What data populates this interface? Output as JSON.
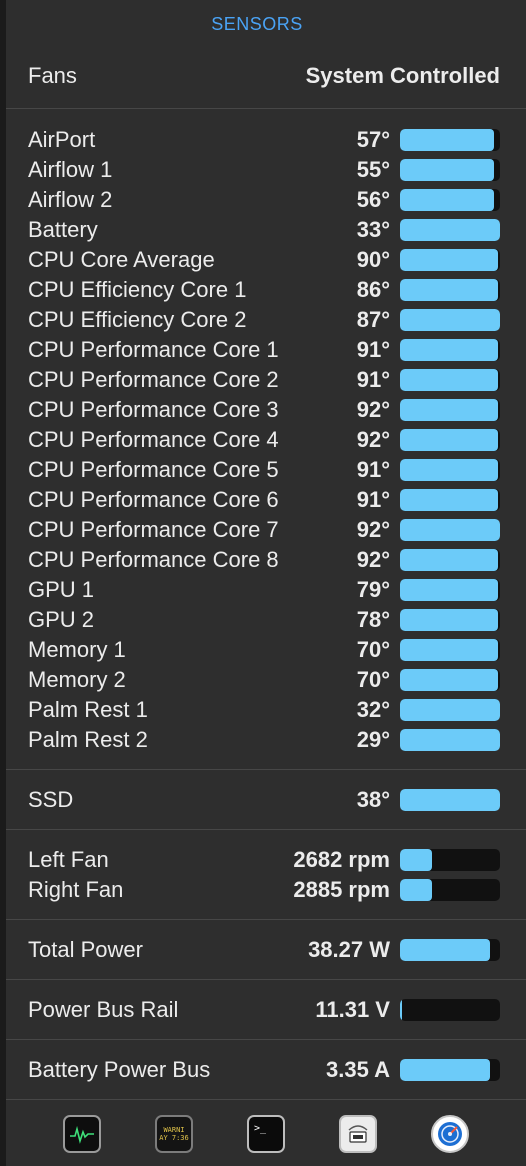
{
  "title": "SENSORS",
  "fans_header": {
    "label": "Fans",
    "value": "System Controlled"
  },
  "temperatures": [
    {
      "label": "AirPort",
      "value": "57°",
      "level": 0.94
    },
    {
      "label": "Airflow 1",
      "value": "55°",
      "level": 0.94
    },
    {
      "label": "Airflow 2",
      "value": "56°",
      "level": 0.94
    },
    {
      "label": "Battery",
      "value": "33°",
      "level": 1.0
    },
    {
      "label": "CPU Core Average",
      "value": "90°",
      "level": 0.98
    },
    {
      "label": "CPU Efficiency Core 1",
      "value": "86°",
      "level": 0.98
    },
    {
      "label": "CPU Efficiency Core 2",
      "value": "87°",
      "level": 1.0
    },
    {
      "label": "CPU Performance Core 1",
      "value": "91°",
      "level": 0.98
    },
    {
      "label": "CPU Performance Core 2",
      "value": "91°",
      "level": 0.98
    },
    {
      "label": "CPU Performance Core 3",
      "value": "92°",
      "level": 0.98
    },
    {
      "label": "CPU Performance Core 4",
      "value": "92°",
      "level": 0.98
    },
    {
      "label": "CPU Performance Core 5",
      "value": "91°",
      "level": 0.98
    },
    {
      "label": "CPU Performance Core 6",
      "value": "91°",
      "level": 0.98
    },
    {
      "label": "CPU Performance Core 7",
      "value": "92°",
      "level": 1.0
    },
    {
      "label": "CPU Performance Core 8",
      "value": "92°",
      "level": 0.98
    },
    {
      "label": "GPU 1",
      "value": "79°",
      "level": 0.98
    },
    {
      "label": "GPU 2",
      "value": "78°",
      "level": 0.98
    },
    {
      "label": "Memory 1",
      "value": "70°",
      "level": 0.98
    },
    {
      "label": "Memory 2",
      "value": "70°",
      "level": 0.98
    },
    {
      "label": "Palm Rest 1",
      "value": "32°",
      "level": 1.0
    },
    {
      "label": "Palm Rest 2",
      "value": "29°",
      "level": 1.0
    }
  ],
  "ssd": {
    "label": "SSD",
    "value": "38°",
    "level": 1.0
  },
  "fans": [
    {
      "label": "Left Fan",
      "value": "2682 rpm",
      "level": 0.32
    },
    {
      "label": "Right Fan",
      "value": "2885 rpm",
      "level": 0.32
    }
  ],
  "power": {
    "label": "Total Power",
    "value": "38.27 W",
    "level": 0.9
  },
  "voltage": {
    "label": "Power Bus Rail",
    "value": "11.31 V",
    "level": 0.02
  },
  "current": {
    "label": "Battery Power Bus",
    "value": "3.35 A",
    "level": 0.9
  },
  "dock": [
    {
      "name": "activity-monitor-icon"
    },
    {
      "name": "console-icon",
      "text": "WARNI\nAY 7:36"
    },
    {
      "name": "terminal-icon",
      "text": ">_"
    },
    {
      "name": "system-information-icon"
    },
    {
      "name": "disk-utility-icon"
    }
  ],
  "colors": {
    "accent": "#4aa3f5",
    "bar_fill": "#6ccbf9",
    "bar_track": "#111111",
    "panel": "#2e2e2e"
  }
}
